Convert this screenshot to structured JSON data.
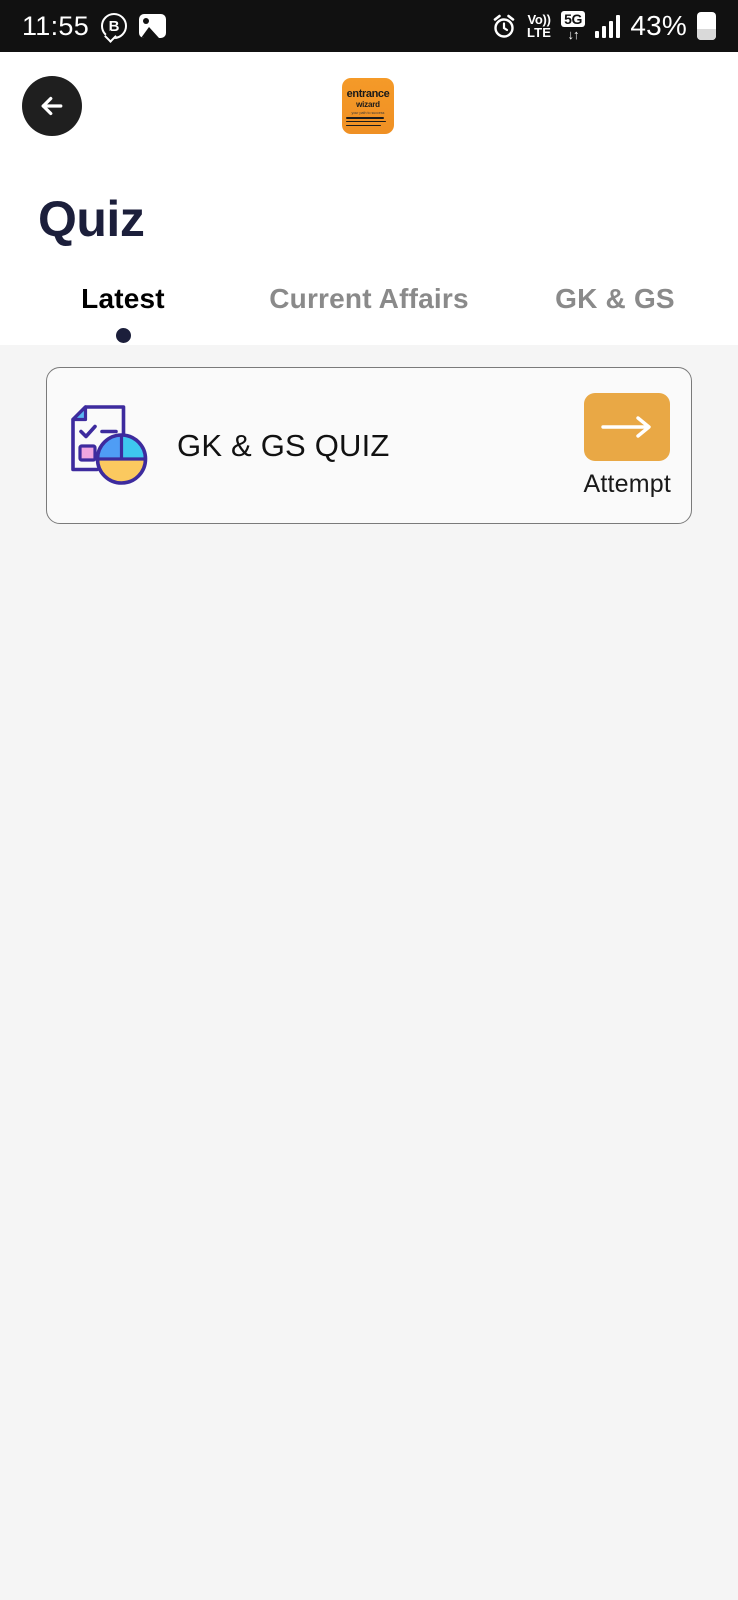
{
  "status_bar": {
    "time": "11:55",
    "left_icons": [
      "whatsapp-business-icon",
      "gallery-icon"
    ],
    "volte_top": "Vo))",
    "volte_bottom": "LTE",
    "network": "5G",
    "network_arrows": "↓↑",
    "battery_percent": "43%",
    "right_icons": [
      "alarm-icon",
      "volte-icon",
      "5g-icon",
      "signal-bars-icon",
      "battery-icon"
    ]
  },
  "header": {
    "back_icon": "back-arrow-icon",
    "logo": {
      "line1": "entrance",
      "line2": "wizard",
      "line3": "your path to success",
      "color": "#ef9024"
    },
    "title": "Quiz"
  },
  "tabs": [
    {
      "label": "Latest",
      "active": true
    },
    {
      "label": "Current Affairs",
      "active": false
    },
    {
      "label": "GK & GS",
      "active": false
    }
  ],
  "quiz_list": [
    {
      "icon": "quiz-clipboard-chart-icon",
      "name": "GK & GS QUIZ",
      "action_icon": "arrow-right-icon",
      "action_label": "Attempt"
    }
  ],
  "colors": {
    "accent": "#e9a845",
    "title": "#1c1f3b",
    "tab_inactive": "#8a8a8a",
    "page_bg": "#f5f5f5",
    "card_bg": "#fafafa",
    "card_border": "#7a7a7a",
    "status_bar_bg": "#111111"
  }
}
